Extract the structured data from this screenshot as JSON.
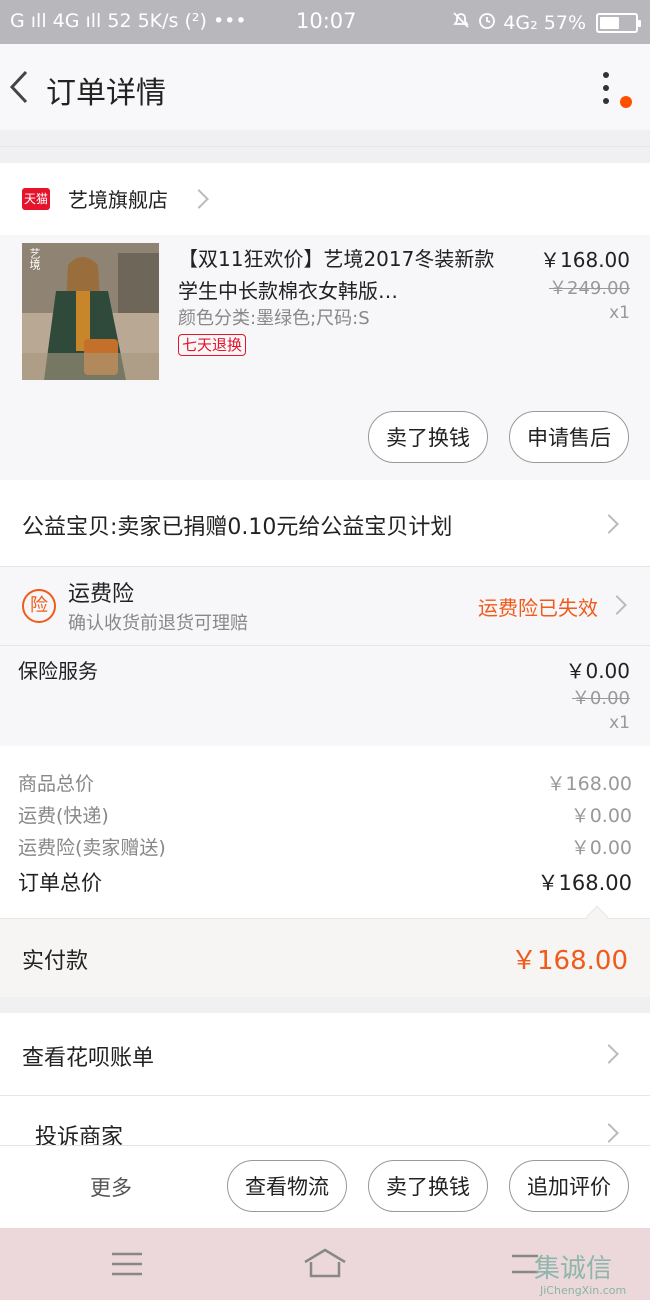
{
  "status_bar": {
    "left": "G ıll 4G ıll 52 5K/s (²) •••",
    "time": "10:07",
    "right": "4G₂ 57%",
    "battery_percent": 57
  },
  "header": {
    "title": "订单详情"
  },
  "shop": {
    "badge": "天猫",
    "name": "艺境旗舰店"
  },
  "item": {
    "thumb_label": "艺境",
    "title": "【双11狂欢价】艺境2017冬装新款学生中长款棉衣女韩版…",
    "sku": "颜色分类:墨绿色;尺码:S",
    "tag": "七天退换",
    "price_now": "￥168.00",
    "price_old": "￥249.00",
    "qty": "x1"
  },
  "item_actions": {
    "sell": "卖了换钱",
    "after_sale": "申请售后"
  },
  "charity": {
    "text": "公益宝贝:卖家已捐赠0.10元给公益宝贝计划"
  },
  "shipping_insurance": {
    "icon": "险",
    "title": "运费险",
    "desc": "确认收货前退货可理赔",
    "status": "运费险已失效"
  },
  "insurance_service": {
    "label": "保险服务",
    "price_now": "￥0.00",
    "price_old": "￥0.00",
    "qty": "x1"
  },
  "summary": {
    "rows": [
      {
        "label": "商品总价",
        "value": "￥168.00"
      },
      {
        "label": "运费(快递)",
        "value": "￥0.00"
      },
      {
        "label": "运费险(卖家赠送)",
        "value": "￥0.00"
      }
    ],
    "total_label": "订单总价",
    "total_value": "￥168.00"
  },
  "paid": {
    "label": "实付款",
    "value": "￥168.00"
  },
  "links": {
    "huabei": "查看花呗账单",
    "complain": "投诉商家"
  },
  "bottom_bar": {
    "more": "更多",
    "logistics": "查看物流",
    "sell": "卖了换钱",
    "review": "追加评价"
  },
  "watermark": {
    "text": "集诚信",
    "sub": "JiChengXin.com"
  },
  "colors": {
    "accent": "#f05a1a",
    "tmall_red": "#e5142b",
    "notification_dot": "#ff5000"
  }
}
